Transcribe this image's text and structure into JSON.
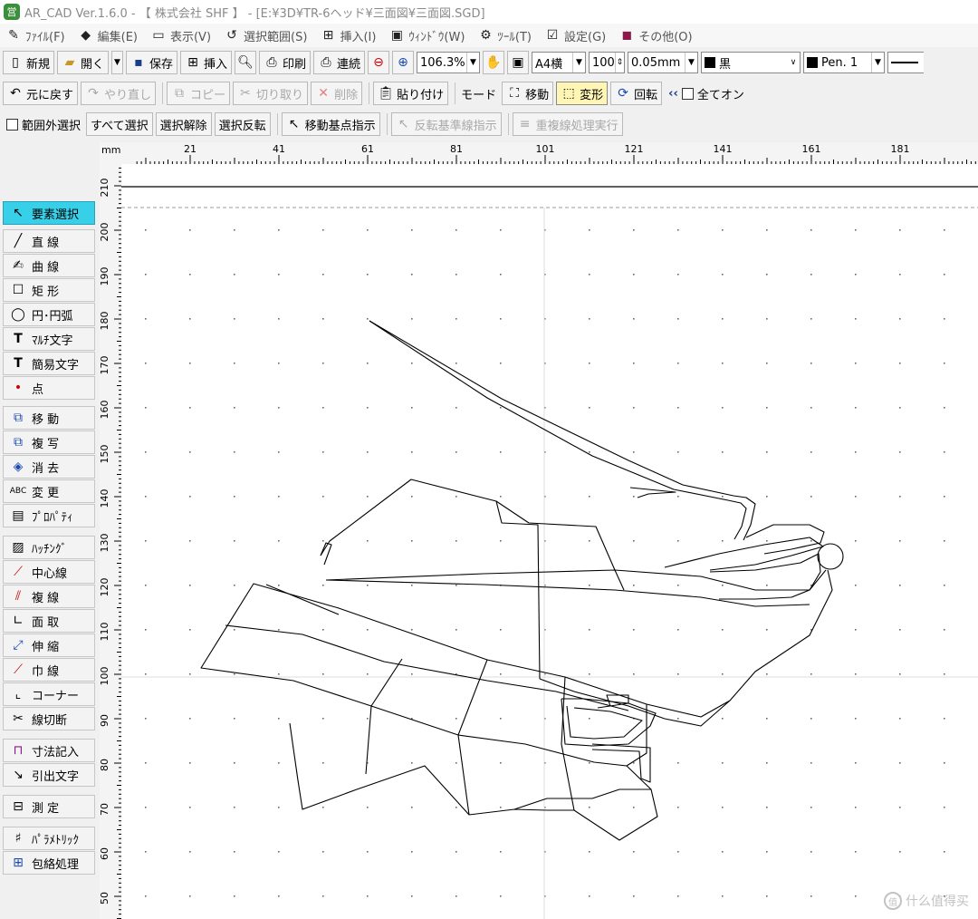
{
  "window": {
    "title": "AR_CAD Ver.1.6.0 - 【 株式会社 SHF 】 - [E:¥3D¥TR-6ヘッド¥三面図¥三面図.SGD]"
  },
  "menu": [
    "ﾌｧｲﾙ(F)",
    "編集(E)",
    "表示(V)",
    "選択範囲(S)",
    "挿入(I)",
    "ｳｨﾝﾄﾞｳ(W)",
    "ﾂｰﾙ(T)",
    "設定(G)",
    "その他(O)"
  ],
  "toolbar1": {
    "new": "新規",
    "open": "開く",
    "save": "保存",
    "insert": "挿入",
    "print": "印刷",
    "continuous": "連続",
    "zoom": "106.3%",
    "paper": "A4横",
    "scale": "100",
    "line_width": "0.05mm",
    "color": "黒",
    "pen": "Pen. 1"
  },
  "toolbar2": {
    "undo": "元に戻す",
    "redo": "やり直し",
    "copy": "コピー",
    "cut": "切り取り",
    "delete": "削除",
    "paste": "貼り付け",
    "mode": "モード",
    "move": "移動",
    "transform": "変形",
    "rotate": "回転",
    "all_on": "全てオン"
  },
  "toolbar3": {
    "out_of_range": "範囲外選択",
    "select_all": "すべて選択",
    "deselect": "選択解除",
    "invert": "選択反転",
    "move_base": "移動基点指示",
    "mirror_base": "反転基準線指示",
    "duplicate": "重複線処理実行"
  },
  "palette": [
    "要素選択",
    "直 線",
    "曲 線",
    "矩 形",
    "円･円弧",
    "ﾏﾙﾁ文字",
    "簡易文字",
    "点",
    "移 動",
    "複 写",
    "消 去",
    "変 更",
    "ﾌﾟﾛﾊﾟﾃｨ",
    "ﾊｯﾁﾝｸﾞ",
    "中心線",
    "複 線",
    "面 取",
    "伸 縮",
    "巾 線",
    "コーナー",
    "線切断",
    "寸法記入",
    "引出文字",
    "測 定",
    "ﾊﾟﾗﾒﾄﾘｯｸ",
    "包絡処理"
  ],
  "canvas": {
    "unit": "mm",
    "ruler_x_labels": [
      "21",
      "41",
      "61",
      "81",
      "101",
      "121",
      "141",
      "161",
      "181"
    ],
    "ruler_y_labels": [
      "210",
      "200",
      "190",
      "180",
      "170",
      "160",
      "150",
      "140",
      "130",
      "120",
      "110",
      "100",
      "90",
      "80",
      "70",
      "60",
      "50"
    ],
    "watermark": "什么值得买"
  }
}
